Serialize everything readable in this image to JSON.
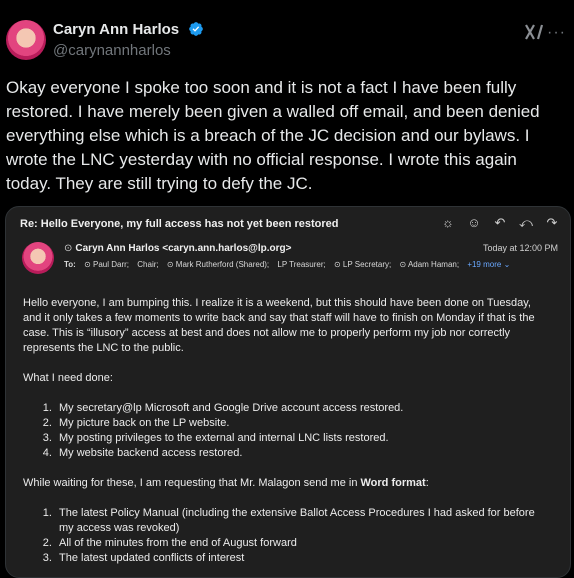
{
  "author": {
    "name": "Caryn Ann Harlos",
    "handle": "@carynannharlos"
  },
  "icons": {
    "verified": "verified-badge-icon",
    "grok": "grok-logo-icon",
    "more": "more-icon"
  },
  "tweet": {
    "text": "Okay everyone I spoke too soon and it is not a fact I have been fully restored.  I have merely been given a walled off email, and been denied everything else which is a breach of the JC decision and our bylaws.  I wrote the LNC yesterday with no official response.  I wrote this again today.  They are still trying to defy the JC."
  },
  "email": {
    "subject": "Re: Hello Everyone, my full access has not yet been restored",
    "sender": "Caryn Ann Harlos <caryn.ann.harlos@lp.org>",
    "timestamp": "Today at 12:00 PM",
    "to_label": "To:",
    "recipients": [
      "Paul Darr;",
      "Chair;",
      "Mark Rutherford (Shared);",
      "LP Treasurer;",
      "LP Secretary;",
      "Adam Haman;"
    ],
    "more_recipients": "+19 more",
    "body": {
      "para1": "Hello everyone, I am bumping this.  I realize it is a weekend, but this should have been done on Tuesday, and it only takes a few moments to write back and say that staff will have to finish on Monday if that is the case.  This is “illusory” access at best and does not allow me to properly perform my job nor correctly represents the LNC to the public.",
      "para2": "What I need done:",
      "needs": [
        "My secretary@lp Microsoft and Google Drive account access restored.",
        "My picture back on the LP website.",
        "My posting privileges to the external and internal LNC lists restored.",
        "My website backend access restored."
      ],
      "para3_prefix": "While waiting for these, I am requesting that Mr. Malagon send me in ",
      "para3_bold": "Word format",
      "para3_suffix": ":",
      "requests": [
        "The latest Policy Manual (including the extensive Ballot Access Procedures I had asked for before my access was revoked)",
        "All of the minutes from the end of August forward",
        "The latest updated conflicts of interest"
      ]
    }
  }
}
